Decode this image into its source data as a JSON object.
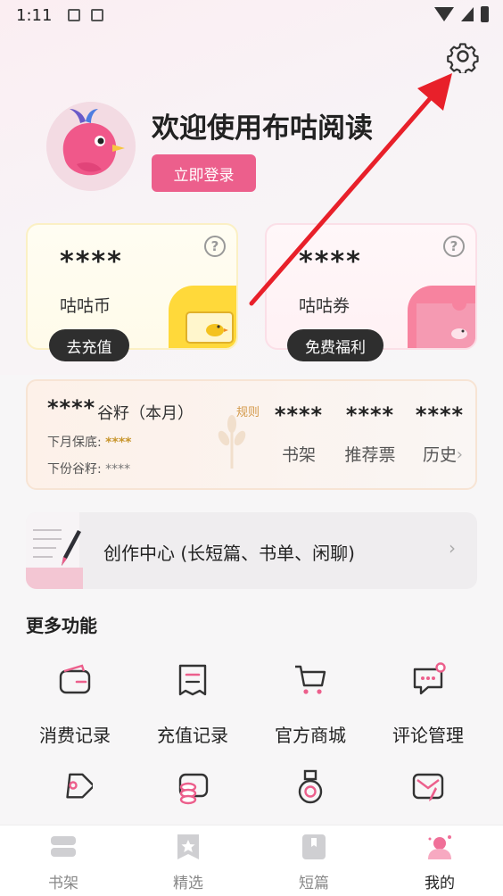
{
  "status_bar": {
    "time": "1:11"
  },
  "profile": {
    "welcome": "欢迎使用布咕阅读",
    "login_label": "立即登录"
  },
  "wallet": {
    "coin": {
      "value": "****",
      "label": "咕咕币",
      "action": "去充值",
      "help": "?"
    },
    "coupon": {
      "value": "****",
      "label": "咕咕券",
      "action": "免费福利",
      "help": "?"
    }
  },
  "grain": {
    "value": "****",
    "title": "谷籽（本月）",
    "rule": "规则",
    "next_min_label": "下月保底:",
    "next_min_value": "****",
    "next_grain_label": "下份谷籽:",
    "next_grain_value": "****",
    "stats": [
      {
        "value": "****",
        "label": "书架"
      },
      {
        "value": "****",
        "label": "推荐票"
      },
      {
        "value": "****",
        "label": "历史"
      }
    ],
    "chevron": "›"
  },
  "create_center": {
    "label": "创作中心 (长短篇、书单、闲聊)",
    "chevron": "›"
  },
  "more": {
    "title": "更多功能",
    "items": [
      {
        "label": "消费记录",
        "icon": "wallet-icon"
      },
      {
        "label": "充值记录",
        "icon": "receipt-icon"
      },
      {
        "label": "官方商城",
        "icon": "cart-icon"
      },
      {
        "label": "评论管理",
        "icon": "comment-icon"
      },
      {
        "label": "",
        "icon": "tag-icon"
      },
      {
        "label": "",
        "icon": "coins-icon"
      },
      {
        "label": "",
        "icon": "medal-icon"
      },
      {
        "label": "",
        "icon": "mail-edit-icon"
      }
    ]
  },
  "nav": {
    "items": [
      {
        "label": "书架",
        "icon": "bookshelf-icon",
        "active": false
      },
      {
        "label": "精选",
        "icon": "star-icon",
        "active": false
      },
      {
        "label": "短篇",
        "icon": "bookmark-icon",
        "active": false
      },
      {
        "label": "我的",
        "icon": "profile-icon",
        "active": true
      }
    ]
  },
  "colors": {
    "accent": "#ec5f8c",
    "gold": "#ffd93a",
    "annotation_arrow": "#e8202a"
  }
}
